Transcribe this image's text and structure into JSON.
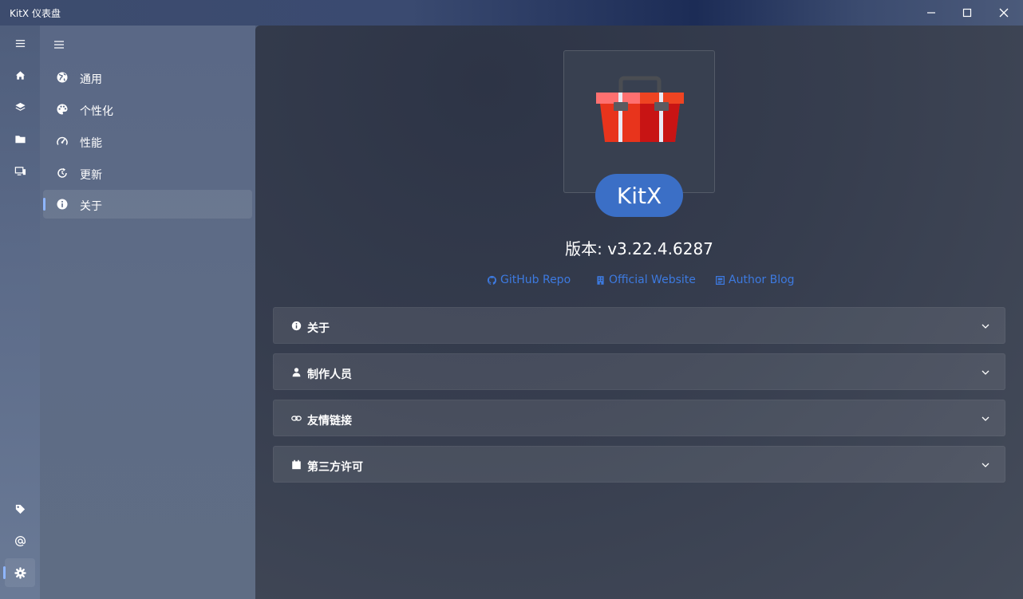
{
  "window": {
    "title": "KitX 仪表盘"
  },
  "rail": {
    "items": [
      {
        "name": "menu"
      },
      {
        "name": "home"
      },
      {
        "name": "plugins"
      },
      {
        "name": "repository"
      },
      {
        "name": "devices"
      },
      {
        "name": "tags"
      },
      {
        "name": "account"
      },
      {
        "name": "settings"
      }
    ],
    "active": "settings"
  },
  "settings_nav": {
    "items": [
      {
        "label": "通用",
        "icon": "globe-icon"
      },
      {
        "label": "个性化",
        "icon": "palette-icon"
      },
      {
        "label": "性能",
        "icon": "speedometer-icon"
      },
      {
        "label": "更新",
        "icon": "refresh-icon"
      },
      {
        "label": "关于",
        "icon": "info-icon"
      }
    ],
    "active": "关于"
  },
  "about": {
    "app_name": "KitX",
    "version": "版本: v3.22.4.6287",
    "links": [
      {
        "label": "GitHub Repo",
        "icon": "github-icon"
      },
      {
        "label": "Official Website",
        "icon": "building-icon"
      },
      {
        "label": "Author Blog",
        "icon": "blog-icon"
      }
    ],
    "sections": [
      {
        "label": "关于",
        "icon": "info-icon"
      },
      {
        "label": "制作人员",
        "icon": "person-icon"
      },
      {
        "label": "友情链接",
        "icon": "link-icon"
      },
      {
        "label": "第三方许可",
        "icon": "calendar-icon"
      }
    ]
  },
  "colors": {
    "accent": "#3b6fc6",
    "link": "#3d7ae0",
    "indicator": "#8fb6ff",
    "toolbox_red": "#e8341c"
  }
}
